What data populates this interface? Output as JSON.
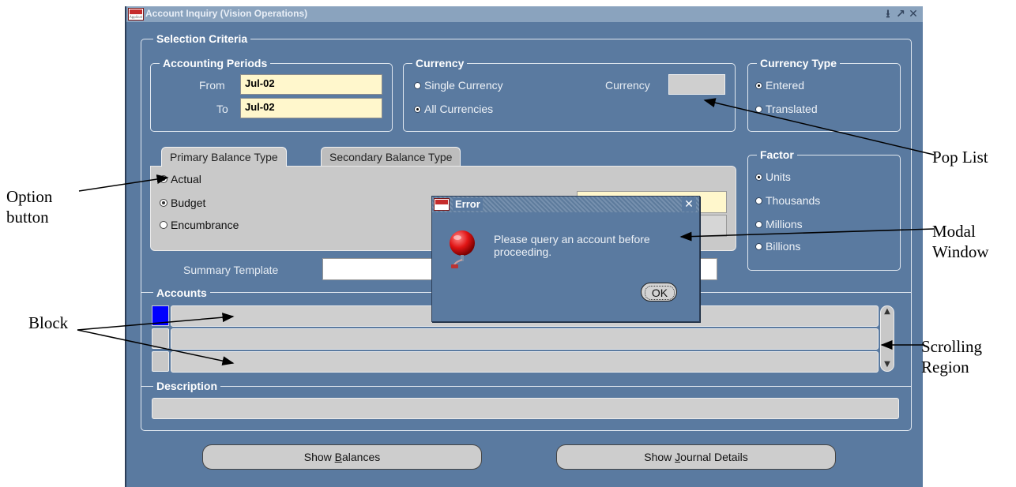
{
  "window": {
    "title": "Account Inquiry (Vision Operations)",
    "logo_text": "ORACLE",
    "logo_subtext": "Applications",
    "controls": [
      "⭳",
      "↗",
      "✕"
    ]
  },
  "selection_criteria": {
    "label": "Selection Criteria",
    "accounting_periods": {
      "label": "Accounting Periods",
      "from_label": "From",
      "from_value": "Jul-02",
      "to_label": "To",
      "to_value": "Jul-02"
    },
    "currency": {
      "label": "Currency",
      "options": [
        {
          "label": "Single Currency",
          "selected": false
        },
        {
          "label": "All Currencies",
          "selected": true
        }
      ],
      "currency_label": "Currency",
      "currency_value": ""
    },
    "currency_type": {
      "label": "Currency Type",
      "options": [
        {
          "label": "Entered",
          "selected": true
        },
        {
          "label": "Translated",
          "selected": false
        }
      ]
    },
    "tabs": [
      {
        "label": "Primary Balance Type",
        "active": true
      },
      {
        "label": "Secondary Balance Type",
        "active": false
      }
    ],
    "balance_types": [
      {
        "label": "Actual",
        "selected": true
      },
      {
        "label": "Budget",
        "selected": true
      },
      {
        "label": "Encumbrance",
        "selected": false
      }
    ],
    "factor": {
      "label": "Factor",
      "options": [
        {
          "label": "Units",
          "selected": true
        },
        {
          "label": "Thousands",
          "selected": false
        },
        {
          "label": "Millions",
          "selected": false
        },
        {
          "label": "Billions",
          "selected": false
        }
      ]
    },
    "summary_template_label": "Summary Template",
    "summary_template_value": ""
  },
  "accounts": {
    "label": "Accounts",
    "rows": [
      "",
      "",
      ""
    ]
  },
  "description": {
    "label": "Description",
    "value": ""
  },
  "buttons": {
    "show_balances_pre": "Show ",
    "show_balances_key": "B",
    "show_balances_post": "alances",
    "show_journal_pre": "Show ",
    "show_journal_key": "J",
    "show_journal_post": "ournal Details"
  },
  "modal": {
    "title": "Error",
    "close": "✕",
    "message": "Please query an account before proceeding.",
    "ok_label": "OK"
  },
  "callouts": {
    "pop_list": "Pop List",
    "option_button": "Option\nbutton",
    "modal_window": "Modal\nWindow",
    "block": "Block",
    "scrolling_region": "Scrolling\nRegion"
  },
  "colors": {
    "window_bg": "#5a7aa0",
    "field_yellow": "#fff7cc",
    "titlebar": "#8aa3be",
    "selected_row_indicator": "#0000ff"
  }
}
